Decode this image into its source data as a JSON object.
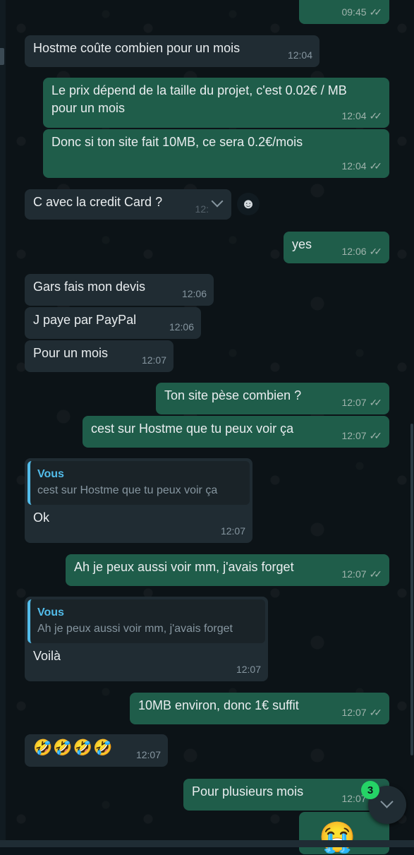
{
  "messages": [
    {
      "id": "m0",
      "direction": "out",
      "text": "",
      "time": "09:45",
      "ticks": "✓✓"
    },
    {
      "id": "m1",
      "direction": "in",
      "text": "Hostme coûte combien pour un mois",
      "time": "12:04"
    },
    {
      "id": "m2",
      "direction": "out",
      "text": "Le prix dépend de la taille du projet, c'est 0.02€ / MB pour un mois",
      "time": "12:04",
      "ticks": "✓✓"
    },
    {
      "id": "m3",
      "direction": "out",
      "text": "Donc si ton site fait 10MB, ce sera 0.2€/mois",
      "time": "12:04",
      "ticks": "✓✓"
    },
    {
      "id": "m4",
      "direction": "in",
      "text": "C avec la credit Card ?",
      "time": "12:"
    },
    {
      "id": "m5",
      "direction": "out",
      "text": "yes",
      "time": "12:06",
      "ticks": "✓✓"
    },
    {
      "id": "m6",
      "direction": "in",
      "text": "Gars fais mon devis",
      "time": "12:06"
    },
    {
      "id": "m7",
      "direction": "in",
      "text": "J paye par PayPal",
      "time": "12:06"
    },
    {
      "id": "m8",
      "direction": "in",
      "text": "Pour un mois",
      "time": "12:07"
    },
    {
      "id": "m9",
      "direction": "out",
      "text": "Ton site pèse combien ?",
      "time": "12:07",
      "ticks": "✓✓"
    },
    {
      "id": "m10",
      "direction": "out",
      "text": "cest sur Hostme que tu peux voir ça",
      "time": "12:07",
      "ticks": "✓✓"
    },
    {
      "id": "m11",
      "direction": "in",
      "quote_author": "Vous",
      "quote_text": "cest sur Hostme que tu peux voir ça",
      "text": "Ok",
      "time": "12:07"
    },
    {
      "id": "m12",
      "direction": "out",
      "text": "Ah je peux aussi voir mm, j'avais forget",
      "time": "12:07",
      "ticks": "✓✓"
    },
    {
      "id": "m13",
      "direction": "in",
      "quote_author": "Vous",
      "quote_text": "Ah je peux aussi voir mm, j'avais forget",
      "text": "Voilà",
      "time": "12:07"
    },
    {
      "id": "m14",
      "direction": "out",
      "text": "10MB environ, donc 1€ suffit",
      "time": "12:07",
      "ticks": "✓✓"
    },
    {
      "id": "m15",
      "direction": "in",
      "text": "🤣🤣🤣🤣",
      "time": "12:07"
    },
    {
      "id": "m16",
      "direction": "out",
      "text": "Pour plusieurs mois",
      "time": "12:07",
      "ticks": "✓✓"
    }
  ],
  "reaction_button_icon": "smiley-icon",
  "reaction_button_glyph": "☻",
  "scroll_down": {
    "unread_count": "3",
    "icon": "chevron-down-icon"
  },
  "partial_emoji": "😭",
  "colors": {
    "incoming": "#202c33",
    "outgoing": "#1f5d4a",
    "quote_accent": "#53bdeb",
    "badge": "#25d366",
    "background": "#0c1317"
  }
}
